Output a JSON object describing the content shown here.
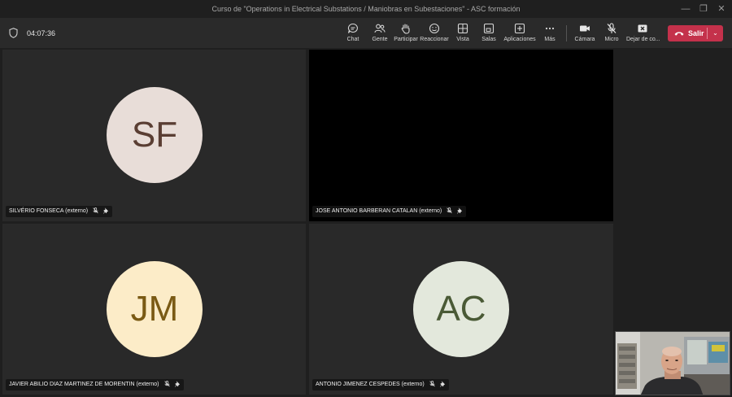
{
  "window": {
    "title": "Curso de \"Operations in Electrical Substations / Maniobras en Subestaciones\" - ASC formación"
  },
  "toolbar": {
    "timer": "04:07:36",
    "buttons": [
      {
        "label": "Chat",
        "icon": "chat-icon"
      },
      {
        "label": "Gente",
        "icon": "people-icon"
      },
      {
        "label": "Participar",
        "icon": "raise-hand-icon"
      },
      {
        "label": "Reaccionar",
        "icon": "smiley-icon"
      },
      {
        "label": "Vista",
        "icon": "grid-view-icon"
      },
      {
        "label": "Salas",
        "icon": "breakout-rooms-icon"
      },
      {
        "label": "Aplicaciones",
        "icon": "add-app-icon"
      },
      {
        "label": "Más",
        "icon": "more-icon"
      },
      {
        "label": "Cámara",
        "icon": "camera-icon"
      },
      {
        "label": "Micro",
        "icon": "mic-muted-icon"
      },
      {
        "label": "Dejar de co...",
        "icon": "stop-sharing-icon"
      }
    ],
    "leave_label": "Salir"
  },
  "participants": [
    {
      "name": "SILVÉRIO FONSECA (externo)",
      "initials": "SF",
      "avatar_bg": "#e8ddd8",
      "initials_color": "#5a3e33",
      "muted": true,
      "pinned": true
    },
    {
      "name": "JOSE ANTONIO BARBERAN CATALAN (externo)",
      "initials": "",
      "video": true,
      "muted": true,
      "pinned": true
    },
    {
      "name": "JAVIER ABILIO DIAZ MARTINEZ DE MORENTIN (externo)",
      "initials": "JM",
      "avatar_bg": "#fcecc8",
      "initials_color": "#7a5a14",
      "muted": true,
      "pinned": true
    },
    {
      "name": "ANTONIO JIMENEZ CESPEDES (externo)",
      "initials": "AC",
      "avatar_bg": "#e3e8dc",
      "initials_color": "#4a5a36",
      "muted": true,
      "pinned": true
    }
  ],
  "colors": {
    "leave_button": "#c4314b",
    "toolbar_bg": "#2a2a2a",
    "stage_bg": "#1f1f1f"
  }
}
